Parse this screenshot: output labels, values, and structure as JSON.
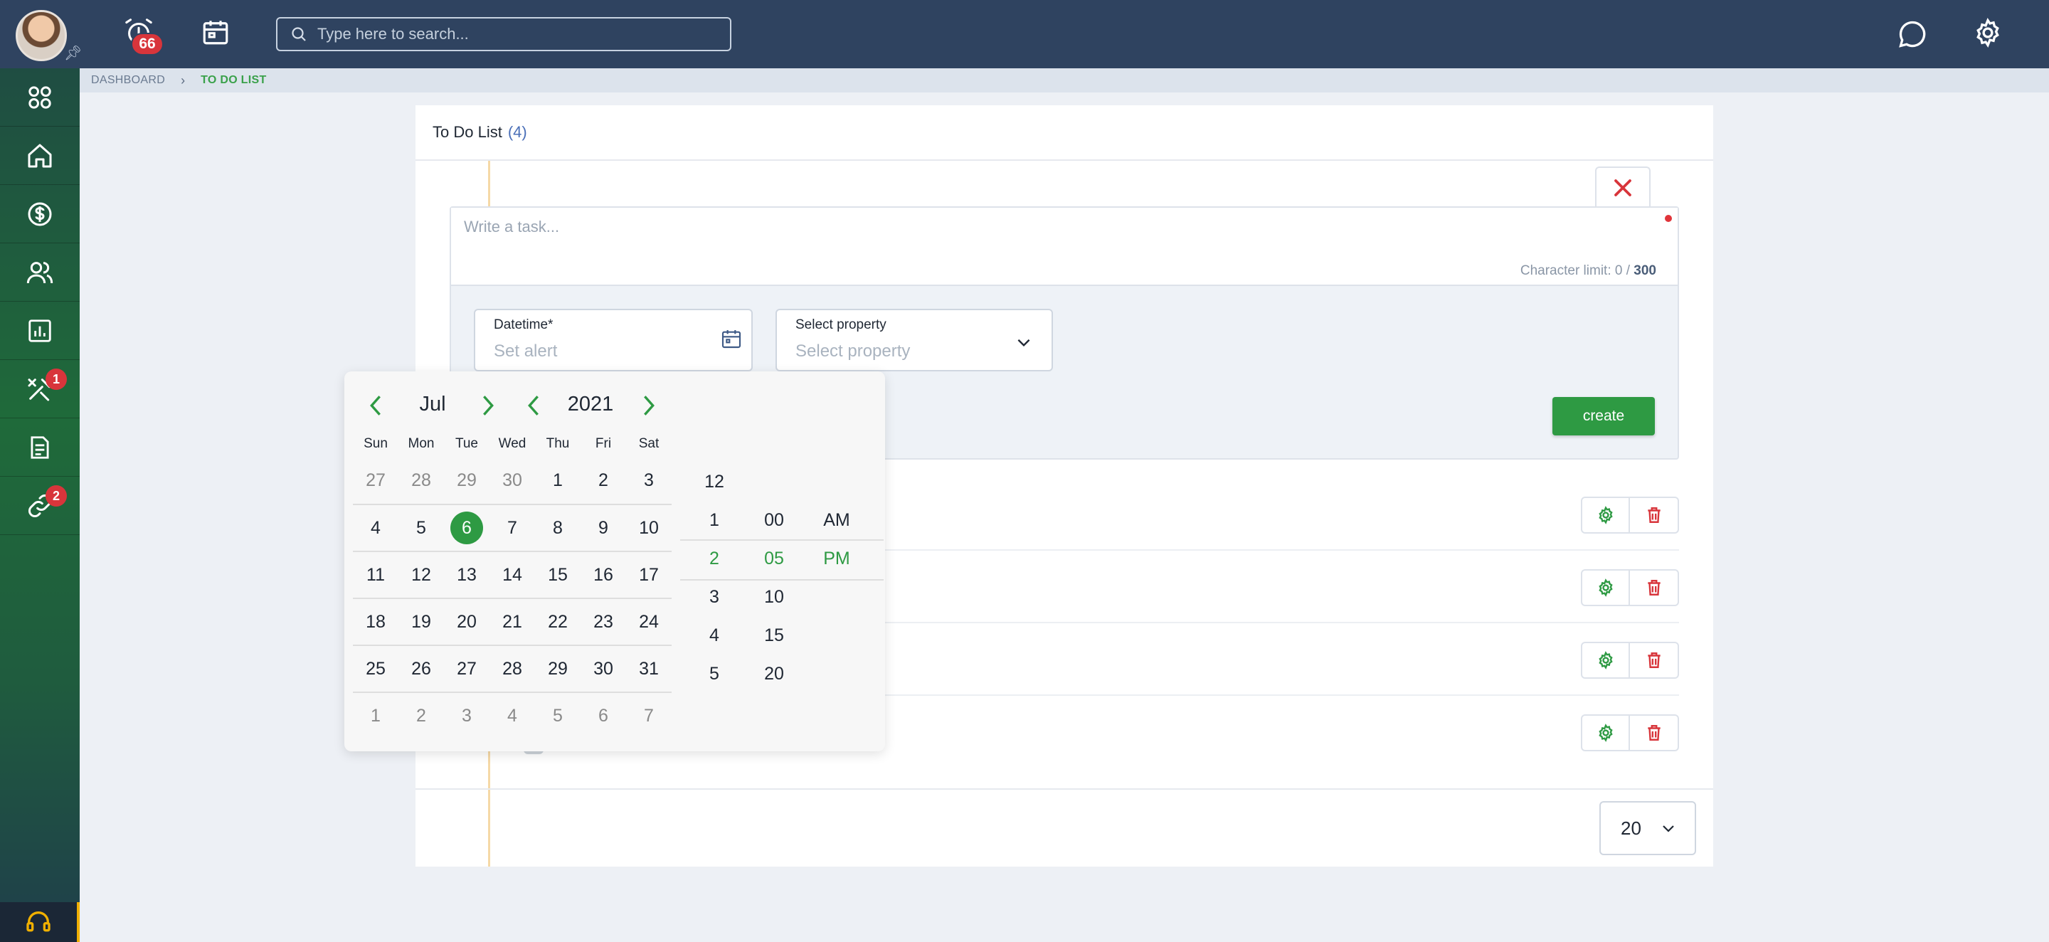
{
  "topbar": {
    "alert_count": "66",
    "search_placeholder": "Type here to search..."
  },
  "sidebar": {
    "tools_badge": "1",
    "links_badge": "2"
  },
  "breadcrumb": {
    "dashboard": "DASHBOARD",
    "current": "TO DO LIST"
  },
  "panel": {
    "title": "To Do List",
    "count": "(4)"
  },
  "form": {
    "task_placeholder": "Write a task...",
    "char_limit_label": "Character limit: 0 / ",
    "char_limit_max": "300",
    "datetime_label": "Datetime*",
    "datetime_placeholder": "Set alert",
    "property_label": "Select property",
    "property_placeholder": "Select property",
    "create_label": "create"
  },
  "pager": {
    "page_size": "20"
  },
  "datepicker": {
    "month": "Jul",
    "year": "2021",
    "weekdays": [
      "Sun",
      "Mon",
      "Tue",
      "Wed",
      "Thu",
      "Fri",
      "Sat"
    ],
    "weeks": [
      [
        "27",
        "28",
        "29",
        "30",
        "1",
        "2",
        "3"
      ],
      [
        "4",
        "5",
        "6",
        "7",
        "8",
        "9",
        "10"
      ],
      [
        "11",
        "12",
        "13",
        "14",
        "15",
        "16",
        "17"
      ],
      [
        "18",
        "19",
        "20",
        "21",
        "22",
        "23",
        "24"
      ],
      [
        "25",
        "26",
        "27",
        "28",
        "29",
        "30",
        "31"
      ],
      [
        "1",
        "2",
        "3",
        "4",
        "5",
        "6",
        "7"
      ]
    ],
    "selected_day": "6",
    "hours": [
      "12",
      "1",
      "2",
      "3",
      "4",
      "5"
    ],
    "minutes": [
      "",
      "00",
      "05",
      "10",
      "15",
      "20"
    ],
    "ampm": [
      "",
      "AM",
      "PM",
      "",
      "",
      ""
    ],
    "selected_hour": "2",
    "selected_minute": "05",
    "selected_ampm": "PM"
  },
  "colors": {
    "accent": "#2e9a43",
    "topbar": "#2f4360",
    "danger": "#d8353b"
  }
}
